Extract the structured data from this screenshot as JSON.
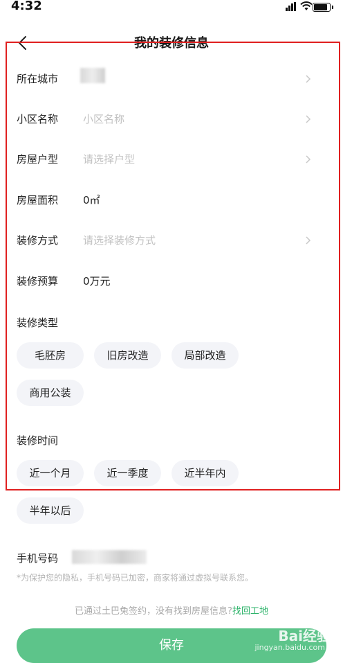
{
  "status_bar": {
    "time": "4:32"
  },
  "nav": {
    "title": "我的装修信息"
  },
  "form": {
    "city": {
      "label": "所在城市",
      "value": ""
    },
    "community": {
      "label": "小区名称",
      "placeholder": "小区名称"
    },
    "layout": {
      "label": "房屋户型",
      "placeholder": "请选择户型"
    },
    "area": {
      "label": "房屋面积",
      "value": "0㎡"
    },
    "method": {
      "label": "装修方式",
      "placeholder": "请选择装修方式"
    },
    "budget": {
      "label": "装修预算",
      "value": "0万元"
    }
  },
  "renovation_type": {
    "label": "装修类型",
    "options": [
      "毛胚房",
      "旧房改造",
      "局部改造",
      "商用公装"
    ]
  },
  "renovation_time": {
    "label": "装修时间",
    "options": [
      "近一个月",
      "近一季度",
      "近半年内",
      "半年以后"
    ]
  },
  "phone": {
    "label": "手机号码",
    "privacy_note": "*为保护您的隐私，手机号码已加密，商家将通过虚拟号联系您。"
  },
  "contract": {
    "text": "已通过土巴兔签约，没有找到房屋信息?",
    "link": "找回工地"
  },
  "save_label": "保存",
  "watermark": {
    "brand": "Bai",
    "brand2": "经验",
    "sub": "jingyan.baidu.com"
  }
}
